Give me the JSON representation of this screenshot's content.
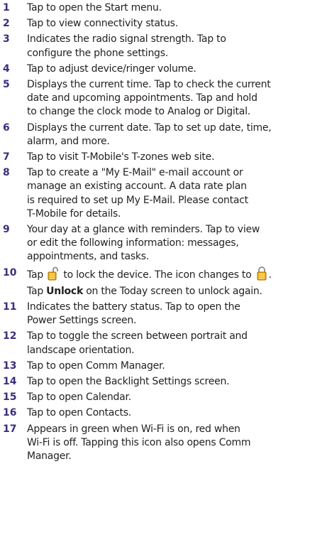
{
  "items": [
    {
      "num": "1",
      "lines": [
        "Tap to open the Start menu."
      ]
    },
    {
      "num": "2",
      "lines": [
        "Tap to view connectivity status."
      ]
    },
    {
      "num": "3",
      "lines": [
        "Indicates the radio signal strength. Tap to",
        "configure the phone settings."
      ]
    },
    {
      "num": "4",
      "lines": [
        "Tap to adjust device/ringer volume."
      ]
    },
    {
      "num": "5",
      "lines": [
        "Displays the current time. Tap to check the current",
        "date and upcoming appointments. Tap and hold",
        "to change the clock mode to Analog or Digital."
      ]
    },
    {
      "num": "6",
      "lines": [
        "Displays the current date. Tap to set up date, time,",
        "alarm, and more."
      ]
    },
    {
      "num": "7",
      "lines": [
        "Tap to visit T-Mobile's T-zones web site."
      ]
    },
    {
      "num": "8",
      "lines": [
        "Tap to create a \"My E-Mail\" e-mail account or",
        "manage an existing account. A data rate plan",
        "is required to set up My E-Mail. Please contact",
        "T-Mobile for details."
      ]
    },
    {
      "num": "9",
      "lines": [
        "Your day at a glance with reminders. Tap to view",
        "or edit the following information: messages,",
        "appointments, and tasks."
      ]
    },
    {
      "num": "10",
      "line1_a": "Tap ",
      "line1_b": " to lock the device. The icon changes to ",
      "line1_c": ".",
      "line2_a": "Tap ",
      "line2_bold": "Unlock",
      "line2_c": " on the Today screen to unlock again."
    },
    {
      "num": "11",
      "lines": [
        "Indicates the battery status. Tap to open the",
        "Power Settings screen."
      ]
    },
    {
      "num": "12",
      "lines": [
        "Tap to toggle the screen between portrait and",
        "landscape orientation."
      ]
    },
    {
      "num": "13",
      "lines": [
        "Tap to open Comm Manager."
      ]
    },
    {
      "num": "14",
      "lines": [
        "Tap to open the Backlight Settings screen."
      ]
    },
    {
      "num": "15",
      "lines": [
        "Tap to open Calendar."
      ]
    },
    {
      "num": "16",
      "lines": [
        "Tap to open Contacts."
      ]
    },
    {
      "num": "17",
      "lines": [
        "Appears in green when Wi-Fi is on, red when",
        "Wi-Fi is off. Tapping this icon also opens Comm",
        "Manager."
      ]
    }
  ],
  "icons": {
    "unlocked": "unlocked-padlock-icon",
    "locked": "locked-padlock-icon"
  }
}
